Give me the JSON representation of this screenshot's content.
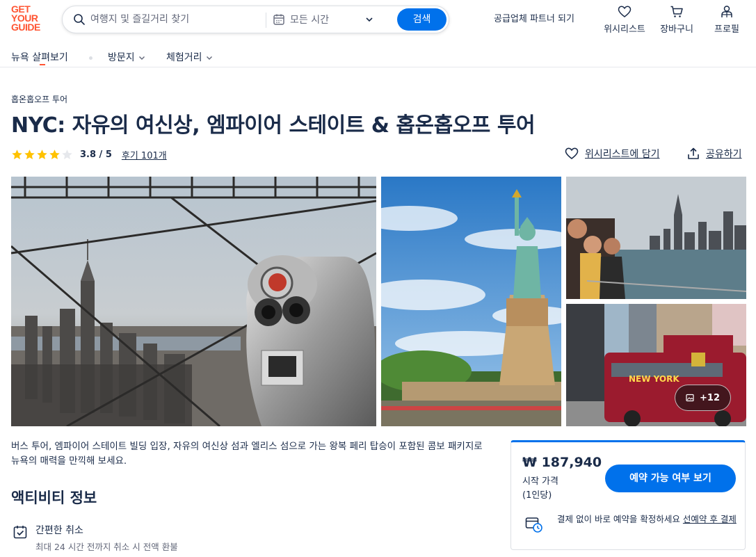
{
  "brand": {
    "logo_lines": [
      "GET",
      "YOUR",
      "GUIDE"
    ],
    "accent": "#ff5533",
    "primary": "#0071eb"
  },
  "search": {
    "placeholder": "여행지 및 즐길거리 찾기",
    "date_label": "모든 시간",
    "button_label": "검색"
  },
  "header": {
    "partner_link": "공급업체 파트너 되기",
    "actions": [
      {
        "label": "위시리스트",
        "icon": "heart-icon"
      },
      {
        "label": "장바구니",
        "icon": "cart-icon"
      },
      {
        "label": "프로필",
        "icon": "profile-icon"
      }
    ]
  },
  "subnav": {
    "items": [
      {
        "label": "뉴욕 살펴보기"
      },
      {
        "label": "방문지"
      },
      {
        "label": "체험거리"
      }
    ]
  },
  "activity": {
    "category": "홉온홉오프 투어",
    "title": "NYC: 자유의 여신상, 엠파이어 스테이트 & 홉온홉오프 투어",
    "rating": 3.8,
    "rating_text": "3.8 / 5",
    "stars_filled": 4,
    "stars_total": 5,
    "reviews_link": "후기 101개",
    "wishlist_label": "위시리스트에 담기",
    "share_label": "공유하기",
    "more_photos": "+12",
    "description": "버스 투어, 엠파이어 스테이트 빌딩 입장, 자유의 여신상 섬과 엘리스 섬으로 가는 왕복 페리 탑승이 포함된 콤보 패키지로 뉴욕의 매력을 만끽해 보세요.",
    "info_title": "액티비티 정보",
    "features": [
      {
        "title": "간편한 취소",
        "subtitle": "최대 24 시간 전까지 취소 시 전액 환불",
        "icon": "calendar-check-icon"
      }
    ]
  },
  "booking": {
    "price": "₩ 187,940",
    "price_from": "시작 가격",
    "price_per": "(1인당)",
    "button_label": "예약 가능 여부 보기",
    "reserve_text": "결제 없이 바로 예약을 확정하세요 ",
    "reserve_link": "선예약 후 결제"
  }
}
